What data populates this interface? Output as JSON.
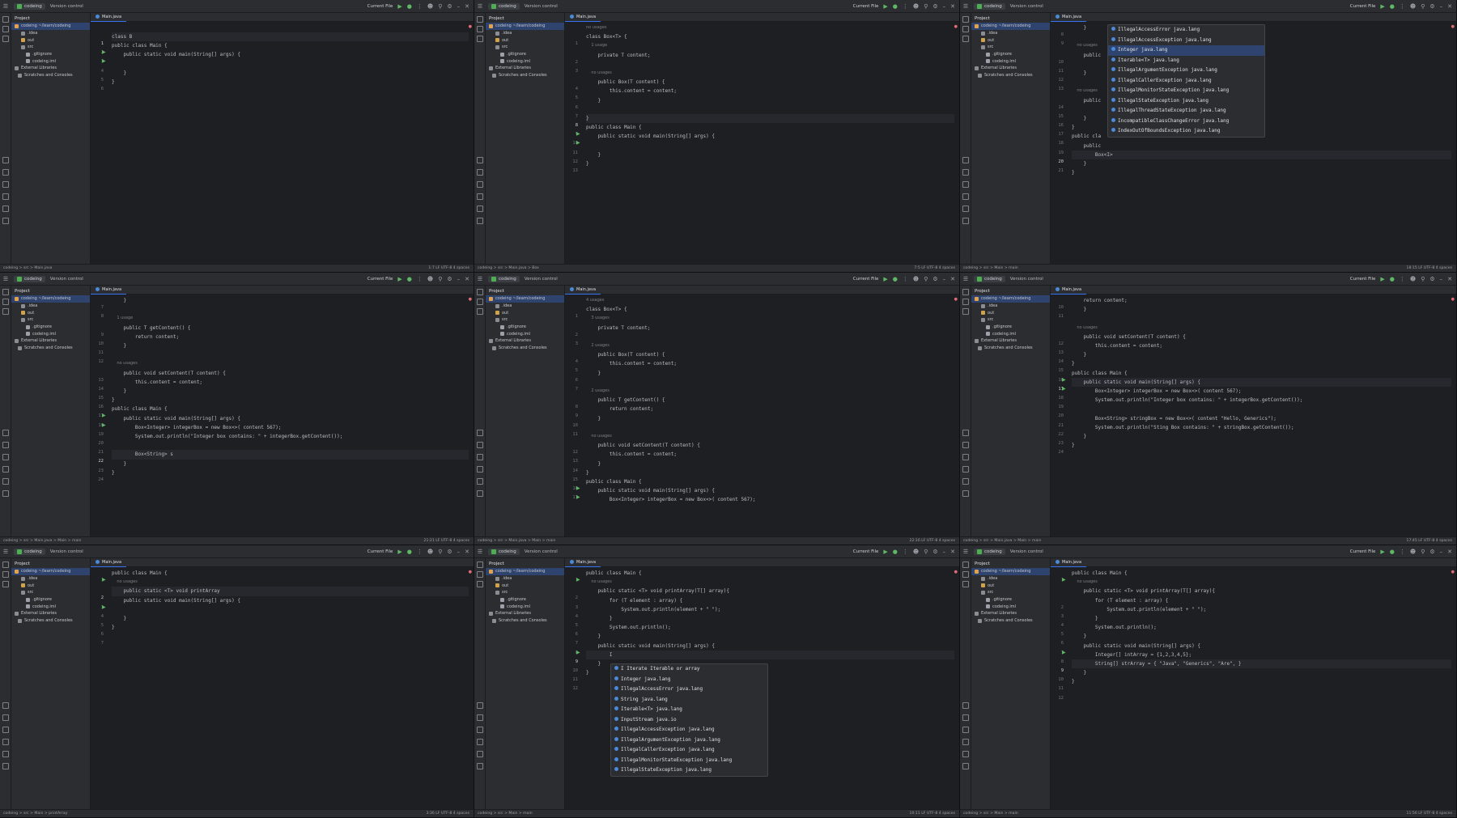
{
  "panels": [
    {
      "project": "codeing",
      "vcs": "Version control",
      "run_config": "Current File",
      "tab": "Main.java",
      "tree_header": "Project",
      "tree": [
        "codeing  ~/learn/codeing",
        ".idea",
        "out",
        "src",
        ".gitignore",
        "codeing.iml",
        "External Libraries",
        "Scratches and Consoles"
      ],
      "numbers": [
        "1",
        "2",
        "3",
        "4",
        "5",
        "6",
        "7"
      ],
      "lines": [
        "class B",
        "public class Main {",
        "    public static void main(String[] args) {",
        "",
        "    }",
        "}"
      ],
      "breadcrumb": "codeing > src > Main.java",
      "status": "1:7  LF  UTF-8  4 spaces"
    },
    {
      "project": "codeing",
      "vcs": "Version control",
      "run_config": "Current File",
      "tab": "Main.java",
      "tree_header": "Project",
      "tree": [
        "codeing  ~/learn/codeing",
        ".idea",
        "out",
        "src",
        ".gitignore",
        "codeing.iml",
        "External Libraries",
        "Scratches and Consoles"
      ],
      "numbers": [
        "1",
        "2",
        "3",
        "4",
        "5",
        "6",
        "7",
        "8",
        "9",
        "10",
        "11",
        "12",
        "13",
        "14"
      ],
      "lines": [
        "no usages",
        "class Box<T> {",
        "    1 usage",
        "    private T content;",
        "",
        "    no usages",
        "    public Box(T content) {",
        "        this.content = content;",
        "    }",
        "",
        "}",
        "public class Main {",
        "    public static void main(String[] args) {",
        "",
        "    }",
        "}"
      ],
      "breadcrumb": "codeing > src > Main.java > Box",
      "status": "7:5  LF  UTF-8  4 spaces"
    },
    {
      "project": "codeing",
      "vcs": "Version control",
      "run_config": "Current File",
      "tab": "Main.java",
      "tree_header": "Project",
      "tree": [
        "codeing  ~/learn/codeing",
        ".idea",
        "out",
        "src",
        ".gitignore",
        "codeing.iml",
        "External Libraries",
        "Scratches and Consoles"
      ],
      "numbers": [
        "8",
        "9",
        "10",
        "11",
        "12",
        "13",
        "14",
        "15",
        "16",
        "17",
        "18",
        "19",
        "20",
        "21"
      ],
      "lines": [
        "    }",
        "",
        "    no usages",
        "    public",
        "",
        "    }",
        "",
        "    no usages",
        "    public",
        "",
        "    }",
        "}",
        "public cla",
        "    public",
        "        Box<I>",
        "    }",
        "}",
        ""
      ],
      "completion": [
        "IllegalAccessError  java.lang",
        "IllegalAccessException  java.lang",
        "Integer  java.lang",
        "Iterable<T>  java.lang",
        "IllegalArgumentException  java.lang",
        "IllegalCallerException  java.lang",
        "IllegalMonitorStateException  java.lang",
        "IllegalStateException  java.lang",
        "IllegalThreadStateException  java.lang",
        "IncompatibleClassChangeError  java.lang",
        "IndexOutOfBoundsException  java.lang"
      ],
      "breadcrumb": "codeing > src > Main > main",
      "status": "18:15  LF  UTF-8  4 spaces"
    },
    {
      "project": "codeing",
      "vcs": "Version control",
      "run_config": "Current File",
      "tab": "Main.java",
      "tree_header": "Project",
      "tree": [
        "codeing  ~/learn/codeing",
        ".idea",
        "out",
        "src",
        ".gitignore",
        "codeing.iml",
        "External Libraries",
        "Scratches and Consoles"
      ],
      "numbers": [
        "7",
        "8",
        "9",
        "10",
        "11",
        "12",
        "13",
        "14",
        "15",
        "16",
        "17",
        "18",
        "19",
        "20",
        "21",
        "22",
        "23",
        "24"
      ],
      "lines": [
        "    }",
        "",
        "    1 usage",
        "    public T getContent() {",
        "        return content;",
        "    }",
        "",
        "    no usages",
        "    public void setContent(T content) {",
        "        this.content = content;",
        "    }",
        "}",
        "public class Main {",
        "    public static void main(String[] args) {",
        "        Box<Integer> integerBox = new Box<>( content 567);",
        "        System.out.println(\"Integer box contains: \" + integerBox.getContent());",
        "",
        "        Box<String> s",
        "    }",
        "}"
      ],
      "breadcrumb": "codeing > src > Main.java > Main > main",
      "status": "21:21  LF  UTF-8  4 spaces"
    },
    {
      "project": "codeing",
      "vcs": "Version control",
      "run_config": "Current File",
      "tab": "Main.java",
      "tree_header": "Project",
      "tree": [
        "codeing  ~/learn/codeing",
        ".idea",
        "out",
        "src",
        ".gitignore",
        "codeing.iml",
        "External Libraries",
        "Scratches and Consoles"
      ],
      "numbers": [
        "1",
        "2",
        "3",
        "4",
        "5",
        "6",
        "7",
        "8",
        "9",
        "10",
        "11",
        "12",
        "13",
        "14",
        "15",
        "16",
        "17"
      ],
      "lines": [
        "4 usages",
        "class Box<T> {",
        "    3 usages",
        "    private T content;",
        "",
        "    2 usages",
        "    public Box(T content) {",
        "        this.content = content;",
        "    }",
        "",
        "    2 usages",
        "    public T getContent() {",
        "        return content;",
        "    }",
        "",
        "    no usages",
        "    public void setContent(T content) {",
        "        this.content = content;",
        "    }",
        "}",
        "public class Main {",
        "    public static void main(String[] args) {",
        "        Box<Integer> integerBox = new Box<>( content 567);"
      ],
      "breadcrumb": "codeing > src > Main.java > Main > main",
      "status": "22:16  LF  UTF-8  4 spaces"
    },
    {
      "project": "codeing",
      "vcs": "Version control",
      "run_config": "Current File",
      "tab": "Main.java",
      "tree_header": "Project",
      "tree": [
        "codeing  ~/learn/codeing",
        ".idea",
        "out",
        "src",
        ".gitignore",
        "codeing.iml",
        "External Libraries",
        "Scratches and Consoles"
      ],
      "numbers": [
        "10",
        "11",
        "",
        "12",
        "13",
        "14",
        "15",
        "16",
        "17",
        "18",
        "19",
        "20",
        "21",
        "22",
        "23",
        "24",
        "25"
      ],
      "lines": [
        "    return content;",
        "    }",
        "",
        "    no usages",
        "    public void setContent(T content) {",
        "        this.content = content;",
        "    }",
        "}",
        "public class Main {",
        "    public static void main(String[] args) {",
        "        Box<Integer> integerBox = new Box<>( content 567);",
        "        System.out.println(\"Integer box contains: \" + integerBox.getContent());",
        "",
        "        Box<String> stringBox = new Box<>( content \"Hello, Generics\");",
        "        System.out.println(\"Sting Box contains: \" + stringBox.getContent());",
        "    }",
        "}"
      ],
      "breadcrumb": "codeing > src > Main.java > Main > main",
      "status": "17:45  LF  UTF-8  4 spaces"
    },
    {
      "project": "codeing",
      "vcs": "Version control",
      "run_config": "Current File",
      "tab": "Main.java",
      "tree_header": "Project",
      "tree": [
        "codeing  ~/learn/codeing",
        ".idea",
        "out",
        "src",
        ".gitignore",
        "codeing.iml",
        "External Libraries",
        "Scratches and Consoles"
      ],
      "numbers": [
        "1",
        "2",
        "3",
        "4",
        "5",
        "6",
        "7",
        "8"
      ],
      "lines": [
        "public class Main {",
        "    no usages",
        "    public static <T> void printArray",
        "    public static void main(String[] args) {",
        "",
        "    }",
        "}",
        ""
      ],
      "breadcrumb": "codeing > src > Main > printArray",
      "status": "3:36  LF  UTF-8  4 spaces"
    },
    {
      "project": "codeing",
      "vcs": "Version control",
      "run_config": "Current File",
      "tab": "Main.java",
      "tree_header": "Project",
      "tree": [
        "codeing  ~/learn/codeing",
        ".idea",
        "out",
        "src",
        ".gitignore",
        "codeing.iml",
        "External Libraries",
        "Scratches and Consoles"
      ],
      "numbers": [
        "1",
        "2",
        "3",
        "4",
        "5",
        "6",
        "7",
        "8",
        "9",
        "10",
        "11",
        "12",
        "13"
      ],
      "lines": [
        "public class Main {",
        "    no usages",
        "    public static <T> void printArray(T[] array){",
        "        for (T element : array) {",
        "            System.out.println(element + \" \");",
        "        }",
        "        System.out.println();",
        "    }",
        "    public static void main(String[] args) {",
        "        I",
        "    }",
        "}",
        ""
      ],
      "completion": [
        "I  Iterate Iterable or array",
        "Integer  java.lang",
        "IllegalAccessError  java.lang",
        "String  java.lang",
        "Iterable<T>  java.lang",
        "InputStream  java.io",
        "IllegalAccessException  java.lang",
        "IllegalArgumentException  java.lang",
        "IllegalCallerException  java.lang",
        "IllegalMonitorStateException  java.lang",
        "IllegalStateException  java.lang"
      ],
      "breadcrumb": "codeing > src > Main > main",
      "status": "10:11  LF  UTF-8  4 spaces"
    },
    {
      "project": "codeing",
      "vcs": "Version control",
      "run_config": "Current File",
      "tab": "Main.java",
      "tree_header": "Project",
      "tree": [
        "codeing  ~/learn/codeing",
        ".idea",
        "out",
        "src",
        ".gitignore",
        "codeing.iml",
        "External Libraries",
        "Scratches and Consoles"
      ],
      "numbers": [
        "1",
        "",
        "2",
        "3",
        "4",
        "5",
        "6",
        "7",
        "8",
        "9",
        "10",
        "11",
        "12",
        "13",
        "14"
      ],
      "lines": [
        "public class Main {",
        "    no usages",
        "    public static <T> void printArray(T[] array){",
        "        for (T element : array) {",
        "            System.out.println(element + \" \");",
        "        }",
        "        System.out.println();",
        "    }",
        "    public static void main(String[] args) {",
        "        Integer[] intArray = {1,2,3,4,5};",
        "        String[] strArray = { \"Java\", \"Generics\", \"Are\", }",
        "    }",
        "}",
        ""
      ],
      "breadcrumb": "codeing > src > Main > main",
      "status": "11:56  LF  UTF-8  4 spaces"
    }
  ],
  "colors": {
    "accent": "#3574f0",
    "run": "#5fb865",
    "error": "#e06c75"
  },
  "icons": {
    "menu": "hamburger-icon",
    "run": "run-icon",
    "debug": "debug-icon",
    "search": "search-icon",
    "settings": "gear-icon"
  }
}
